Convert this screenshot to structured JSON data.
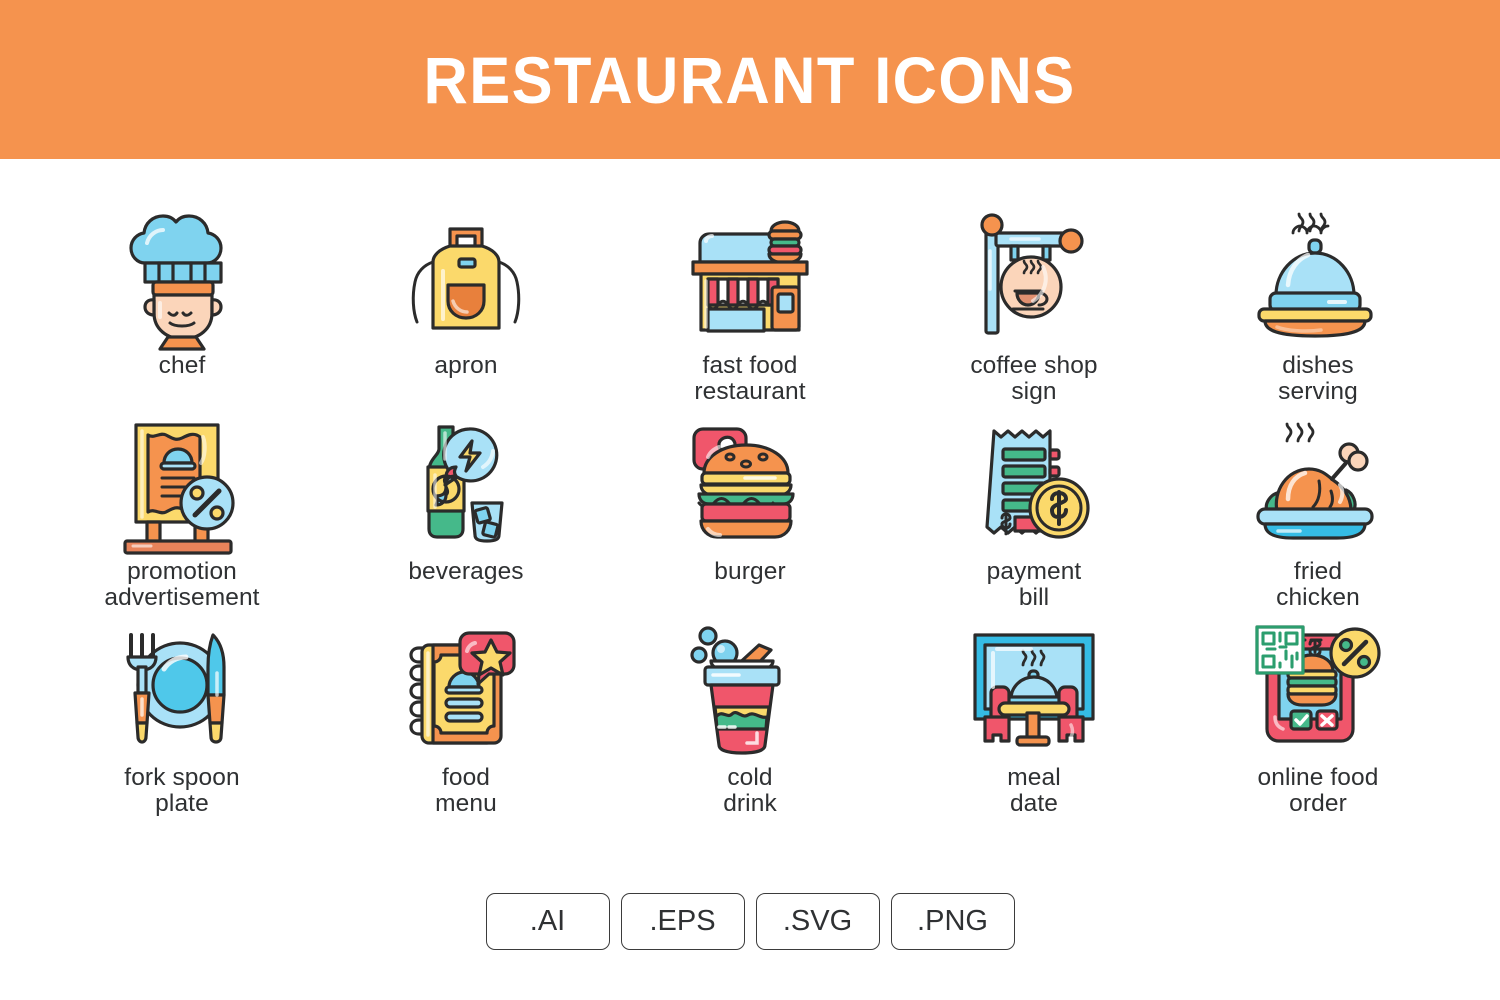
{
  "header": {
    "title": "RESTAURANT ICONS",
    "background_color": "#F5934E",
    "text_color": "#FFFFFF"
  },
  "palette": {
    "orange": "#F5934E",
    "light_blue": "#7FD3EF",
    "sky_blue": "#A9E1F7",
    "yellow": "#FBD96B",
    "green": "#45B98A",
    "red": "#F0566B",
    "peach": "#FBD5BA",
    "outline": "#2B2B2B",
    "label": "#2F3133"
  },
  "icons": [
    {
      "id": "chef",
      "name": "chef",
      "label_lines": [
        "chef"
      ]
    },
    {
      "id": "apron",
      "name": "apron",
      "label_lines": [
        "apron"
      ]
    },
    {
      "id": "fast-food",
      "name": "fast food restaurant",
      "label_lines": [
        "fast food",
        "restaurant"
      ]
    },
    {
      "id": "coffee-sign",
      "name": "coffee shop sign",
      "label_lines": [
        "coffee shop",
        "sign"
      ]
    },
    {
      "id": "dishes-serving",
      "name": "dishes serving",
      "label_lines": [
        "dishes",
        "serving"
      ]
    },
    {
      "id": "promotion",
      "name": "promotion advertisement",
      "label_lines": [
        "promotion",
        "advertisement"
      ]
    },
    {
      "id": "beverages",
      "name": "beverages",
      "label_lines": [
        "beverages"
      ]
    },
    {
      "id": "burger",
      "name": "burger",
      "label_lines": [
        "burger"
      ]
    },
    {
      "id": "payment-bill",
      "name": "payment bill",
      "label_lines": [
        "payment",
        "bill"
      ]
    },
    {
      "id": "fried-chicken",
      "name": "fried chicken",
      "label_lines": [
        "fried",
        "chicken"
      ]
    },
    {
      "id": "fork-spoon-plate",
      "name": "fork spoon plate",
      "label_lines": [
        "fork spoon",
        "plate"
      ]
    },
    {
      "id": "food-menu",
      "name": "food menu",
      "label_lines": [
        "food",
        "menu"
      ]
    },
    {
      "id": "cold-drink",
      "name": "cold drink",
      "label_lines": [
        "cold",
        "drink"
      ]
    },
    {
      "id": "meal-date",
      "name": "meal date",
      "label_lines": [
        "meal",
        "date"
      ]
    },
    {
      "id": "online-food-order",
      "name": "online food order",
      "label_lines": [
        "online food",
        "order"
      ]
    }
  ],
  "formats": [
    {
      "label": ".AI"
    },
    {
      "label": ".EPS"
    },
    {
      "label": ".SVG"
    },
    {
      "label": ".PNG"
    }
  ]
}
